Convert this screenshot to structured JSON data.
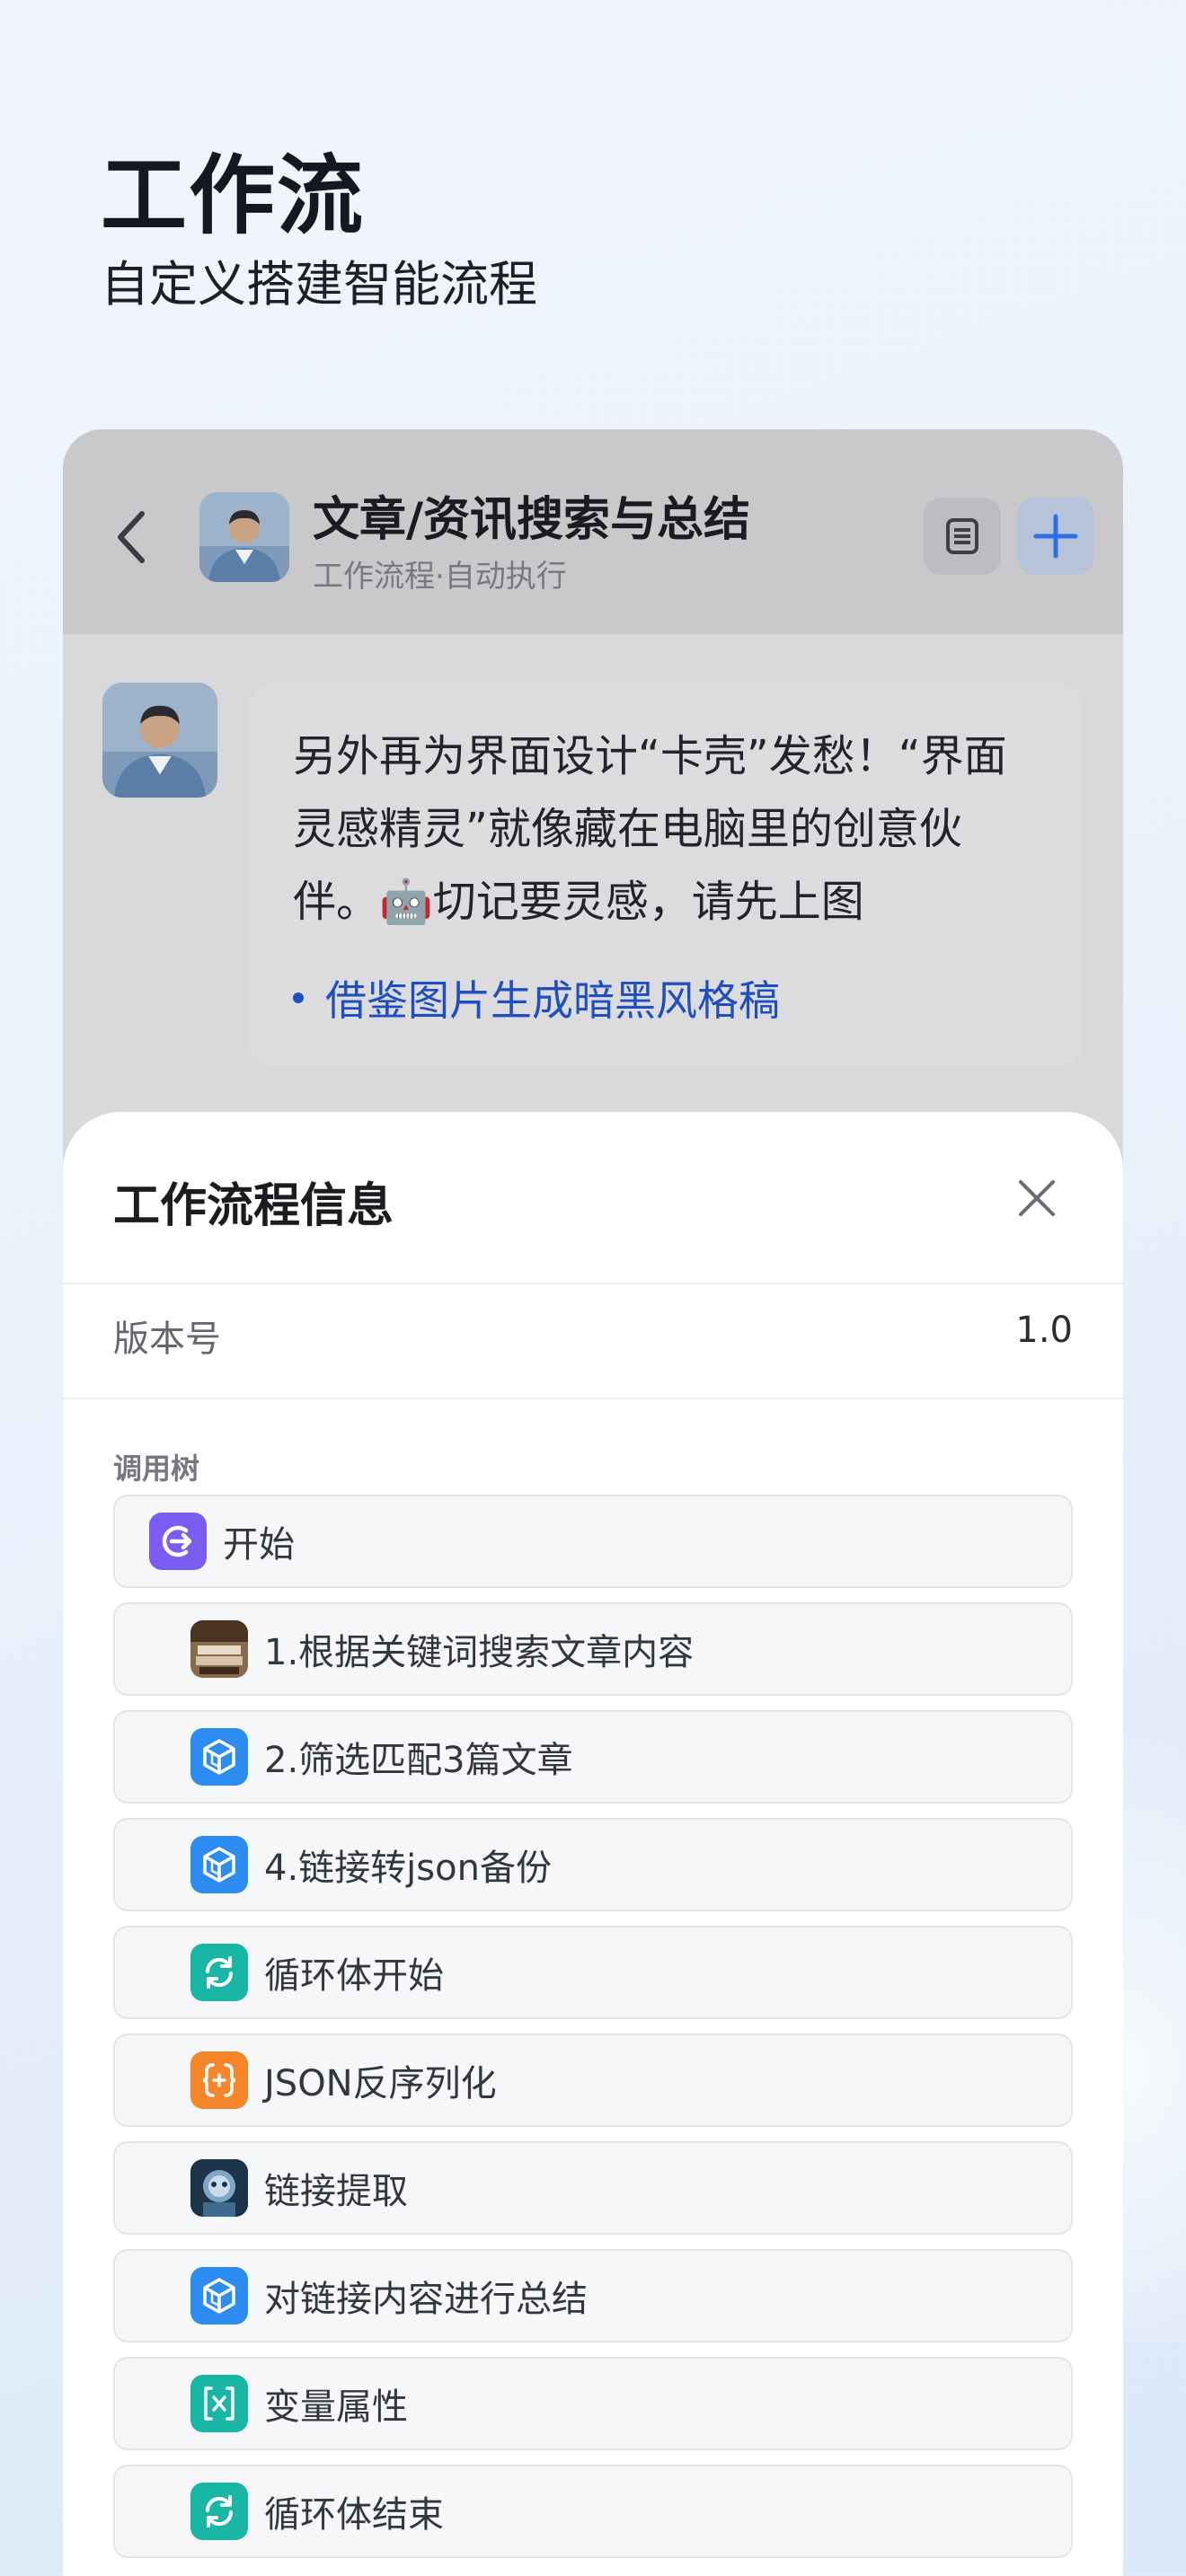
{
  "hero": {
    "title": "工作流",
    "subtitle": "自定义搭建智能流程"
  },
  "chat_header": {
    "title": "文章/资讯搜索与总结",
    "subtitle": "工作流程·自动执行",
    "back_icon": "chevron-left-icon",
    "doc_icon": "document-icon",
    "add_icon": "plus-icon",
    "accent_color": "#2f6fe6"
  },
  "message": {
    "text": "另外再为界面设计“卡壳”发愁！“界面灵感精灵”就像藏在电脑里的创意伙伴。🤖切记要灵感，请先上图",
    "link_label": "借鉴图片生成暗黑风格稿"
  },
  "sheet": {
    "title": "工作流程信息",
    "version_label": "版本号",
    "version_value": "1.0",
    "tree_label": "调用树",
    "nodes": [
      {
        "label": "开始",
        "icon": "start-icon",
        "color": "#7b5cf0",
        "level": 0
      },
      {
        "label": "1.根据关键词搜索文章内容",
        "icon": "book-photo-icon",
        "color": "#6b4a2e",
        "level": 1
      },
      {
        "label": "2.筛选匹配3篇文章",
        "icon": "cube-icon",
        "color": "#2d8cf0",
        "level": 1
      },
      {
        "label": "4.链接转json备份",
        "icon": "cube-icon",
        "color": "#2d8cf0",
        "level": 1
      },
      {
        "label": "循环体开始",
        "icon": "loop-icon",
        "color": "#19b5a5",
        "level": 1
      },
      {
        "label": "JSON反序列化",
        "icon": "json-braces-icon",
        "color": "#f5862a",
        "level": 1
      },
      {
        "label": "链接提取",
        "icon": "robot-photo-icon",
        "color": "#23435e",
        "level": 1
      },
      {
        "label": "对链接内容进行总结",
        "icon": "cube-icon",
        "color": "#2d8cf0",
        "level": 1
      },
      {
        "label": "变量属性",
        "icon": "variable-icon",
        "color": "#19b5a5",
        "level": 1
      },
      {
        "label": "循环体结束",
        "icon": "loop-icon",
        "color": "#19b5a5",
        "level": 1
      }
    ]
  }
}
